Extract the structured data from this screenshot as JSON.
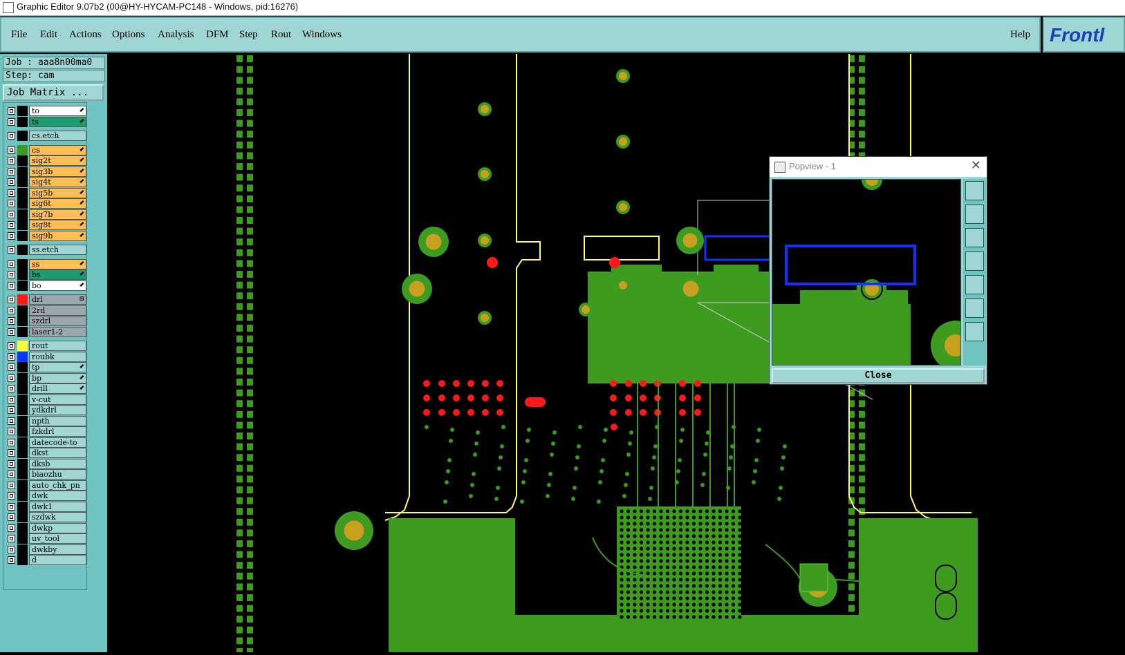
{
  "window": {
    "title": "Graphic Editor 9.07b2 (00@HY-HYCAM-PC148 - Windows, pid:16276)"
  },
  "menu": {
    "file": "File",
    "edit": "Edit",
    "actions": "Actions",
    "options": "Options",
    "analysis": "Analysis",
    "dfm": "DFM",
    "step": "Step",
    "rout": "Rout",
    "windows": "Windows",
    "help": "Help"
  },
  "logo": {
    "text": "Frontl"
  },
  "side": {
    "job": "Job : aaa8n00ma0",
    "step": "Step: cam",
    "job_matrix": "Job Matrix ..."
  },
  "layers": [
    {
      "name": "to",
      "bg": "#ffffff",
      "swatch": "#000000",
      "mark": "⬋"
    },
    {
      "name": "ts",
      "bg": "#1e9c6e",
      "swatch": "#000000",
      "mark": "⬋"
    },
    {
      "name": "cs.etch",
      "bg": "#9fd5d2",
      "swatch": "#000000",
      "mark": ""
    },
    {
      "name": "cs",
      "bg": "#ffbf55",
      "swatch": "#3d9c1f",
      "mark": "⬋"
    },
    {
      "name": "sig2t",
      "bg": "#ffbf55",
      "swatch": "#000000",
      "mark": "⬋"
    },
    {
      "name": "sig3b",
      "bg": "#ffbf55",
      "swatch": "#000000",
      "mark": "⬋"
    },
    {
      "name": "sig4t",
      "bg": "#ffbf55",
      "swatch": "#000000",
      "mark": "⬋"
    },
    {
      "name": "sig5b",
      "bg": "#ffbf55",
      "swatch": "#000000",
      "mark": "⬋"
    },
    {
      "name": "sig6t",
      "bg": "#ffbf55",
      "swatch": "#000000",
      "mark": "⬋"
    },
    {
      "name": "sig7b",
      "bg": "#ffbf55",
      "swatch": "#000000",
      "mark": "⬋"
    },
    {
      "name": "sig8t",
      "bg": "#ffbf55",
      "swatch": "#000000",
      "mark": "⬋"
    },
    {
      "name": "sig9b",
      "bg": "#ffbf55",
      "swatch": "#000000",
      "mark": "⬋"
    },
    {
      "name": "ss.etch",
      "bg": "#9fd5d2",
      "swatch": "#000000",
      "mark": ""
    },
    {
      "name": "ss",
      "bg": "#ffbf55",
      "swatch": "#000000",
      "mark": "⬋"
    },
    {
      "name": "bs",
      "bg": "#1e9c6e",
      "swatch": "#000000",
      "mark": "⬋"
    },
    {
      "name": "bo",
      "bg": "#ffffff",
      "swatch": "#000000",
      "mark": "⬋"
    },
    {
      "name": "drl",
      "bg": "#9aa7ac",
      "swatch": "#ff1a1a",
      "mark": "⊞"
    },
    {
      "name": "2rd",
      "bg": "#9aa7ac",
      "swatch": "#000000",
      "mark": ""
    },
    {
      "name": "szdrl",
      "bg": "#9aa7ac",
      "swatch": "#000000",
      "mark": ""
    },
    {
      "name": "laser1-2",
      "bg": "#9aa7ac",
      "swatch": "#000000",
      "mark": ""
    },
    {
      "name": "rout",
      "bg": "#9fd5d2",
      "swatch": "#ffff33",
      "mark": ""
    },
    {
      "name": "roubk",
      "bg": "#9fd5d2",
      "swatch": "#1133ff",
      "mark": ""
    },
    {
      "name": "tp",
      "bg": "#9fd5d2",
      "swatch": "#000000",
      "mark": "⬋"
    },
    {
      "name": "bp",
      "bg": "#9fd5d2",
      "swatch": "#000000",
      "mark": "⬋"
    },
    {
      "name": "drill",
      "bg": "#9fd5d2",
      "swatch": "#000000",
      "mark": "⬋"
    },
    {
      "name": "v-cut",
      "bg": "#9fd5d2",
      "swatch": "#000000",
      "mark": ""
    },
    {
      "name": "ydkdrl",
      "bg": "#9fd5d2",
      "swatch": "#000000",
      "mark": ""
    },
    {
      "name": "npth",
      "bg": "#9fd5d2",
      "swatch": "#000000",
      "mark": ""
    },
    {
      "name": "fzkdrl",
      "bg": "#9fd5d2",
      "swatch": "#000000",
      "mark": ""
    },
    {
      "name": "datecode-to",
      "bg": "#9fd5d2",
      "swatch": "#000000",
      "mark": ""
    },
    {
      "name": "dkst",
      "bg": "#9fd5d2",
      "swatch": "#000000",
      "mark": ""
    },
    {
      "name": "dksb",
      "bg": "#9fd5d2",
      "swatch": "#000000",
      "mark": ""
    },
    {
      "name": "biaozhu",
      "bg": "#9fd5d2",
      "swatch": "#000000",
      "mark": ""
    },
    {
      "name": "auto_chk_pn",
      "bg": "#9fd5d2",
      "swatch": "#000000",
      "mark": ""
    },
    {
      "name": "dwk",
      "bg": "#9fd5d2",
      "swatch": "#000000",
      "mark": ""
    },
    {
      "name": "dwk1",
      "bg": "#9fd5d2",
      "swatch": "#000000",
      "mark": ""
    },
    {
      "name": "szdwk",
      "bg": "#9fd5d2",
      "swatch": "#000000",
      "mark": ""
    },
    {
      "name": "dwkp",
      "bg": "#9fd5d2",
      "swatch": "#000000",
      "mark": ""
    },
    {
      "name": "uv_tool",
      "bg": "#9fd5d2",
      "swatch": "#000000",
      "mark": ""
    },
    {
      "name": "dwkby",
      "bg": "#9fd5d2",
      "swatch": "#000000",
      "mark": ""
    },
    {
      "name": "d",
      "bg": "#9fd5d2",
      "swatch": "#000000",
      "mark": ""
    }
  ],
  "popview": {
    "title": "Popview - 1",
    "close_label": "Close"
  },
  "colors": {
    "copper": "#3d9c1f",
    "pad": "#c8a020",
    "outline": "#ffff66",
    "drill": "#ff1a1a",
    "select": "#1133ff",
    "panel": "#9fd5d2"
  }
}
